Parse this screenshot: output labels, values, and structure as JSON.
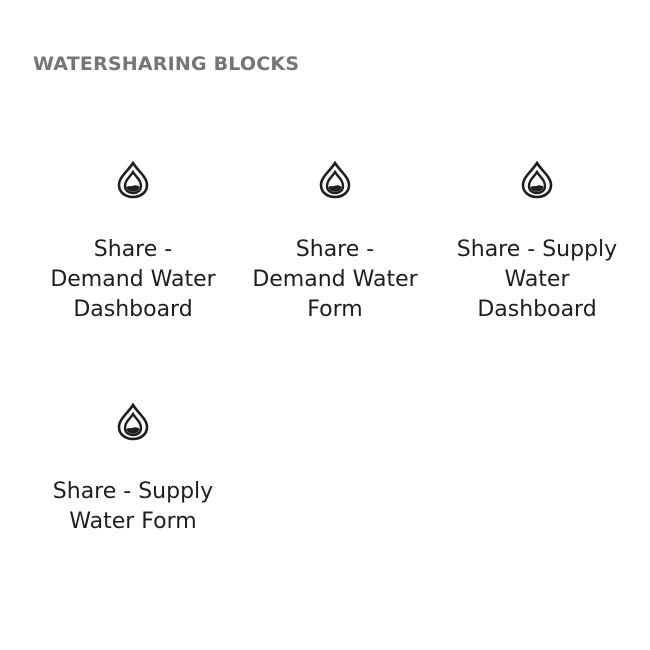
{
  "section": {
    "title": "WATERSHARING BLOCKS"
  },
  "blocks": [
    {
      "label": "Share - Demand Water Dashboard",
      "icon": "water-drop-icon"
    },
    {
      "label": "Share - Demand Water Form",
      "icon": "water-drop-icon"
    },
    {
      "label": "Share - Supply Water Dashboard",
      "icon": "water-drop-icon"
    },
    {
      "label": "Share - Supply Water Form",
      "icon": "water-drop-icon"
    }
  ],
  "colors": {
    "section_title": "#757575",
    "block_label": "#1e1e1e",
    "icon": "#1e1e1e",
    "background": "#ffffff"
  }
}
